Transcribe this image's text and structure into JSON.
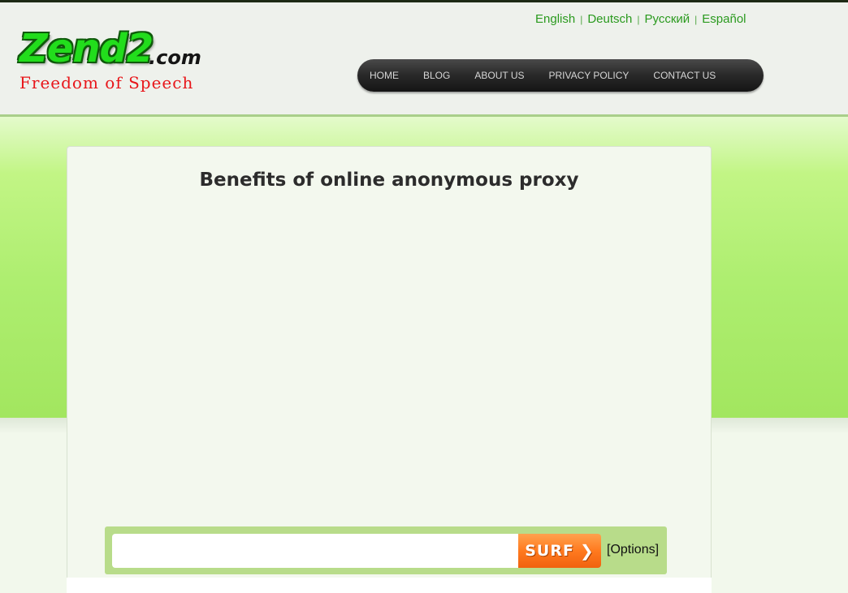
{
  "logo": {
    "main": "Zend2",
    "tld": ".com",
    "tagline": "Freedom of Speech"
  },
  "languages": [
    "English",
    "Deutsch",
    "Русский",
    "Español"
  ],
  "language_separator": "|",
  "nav": {
    "items": [
      "HOME",
      "BLOG",
      "ABOUT US",
      "PRIVACY POLICY",
      "CONTACT US"
    ]
  },
  "main": {
    "title": "Benefits of online anonymous proxy"
  },
  "surf": {
    "input_value": "",
    "button_label": "SURF",
    "button_icon": "chevron-right-icon",
    "options_label": "[Options]"
  },
  "colors": {
    "logo_green": "#22dd1c",
    "tagline_red": "#e8161a",
    "link_green": "#2a9a1e",
    "band_green": "#aeee70",
    "surf_orange": "#ff7a1f"
  }
}
